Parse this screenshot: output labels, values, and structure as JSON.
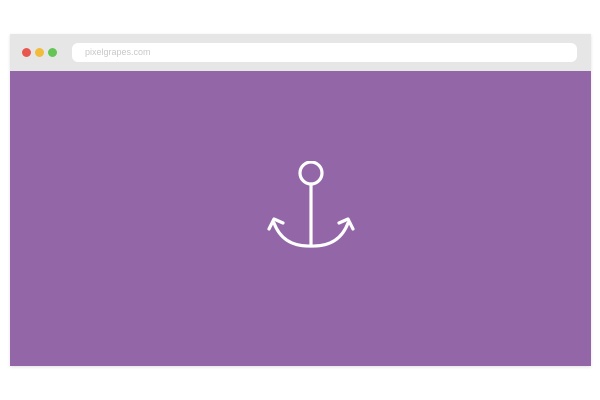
{
  "browser": {
    "url": "pixelgrapes.com",
    "traffic_lights": [
      {
        "name": "close",
        "color": "#e9564f"
      },
      {
        "name": "minimize",
        "color": "#f1bb3c"
      },
      {
        "name": "maximize",
        "color": "#62c554"
      }
    ]
  },
  "page": {
    "background_color": "#9366a8",
    "icon": {
      "name": "anchor-icon",
      "color": "#ffffff"
    }
  }
}
